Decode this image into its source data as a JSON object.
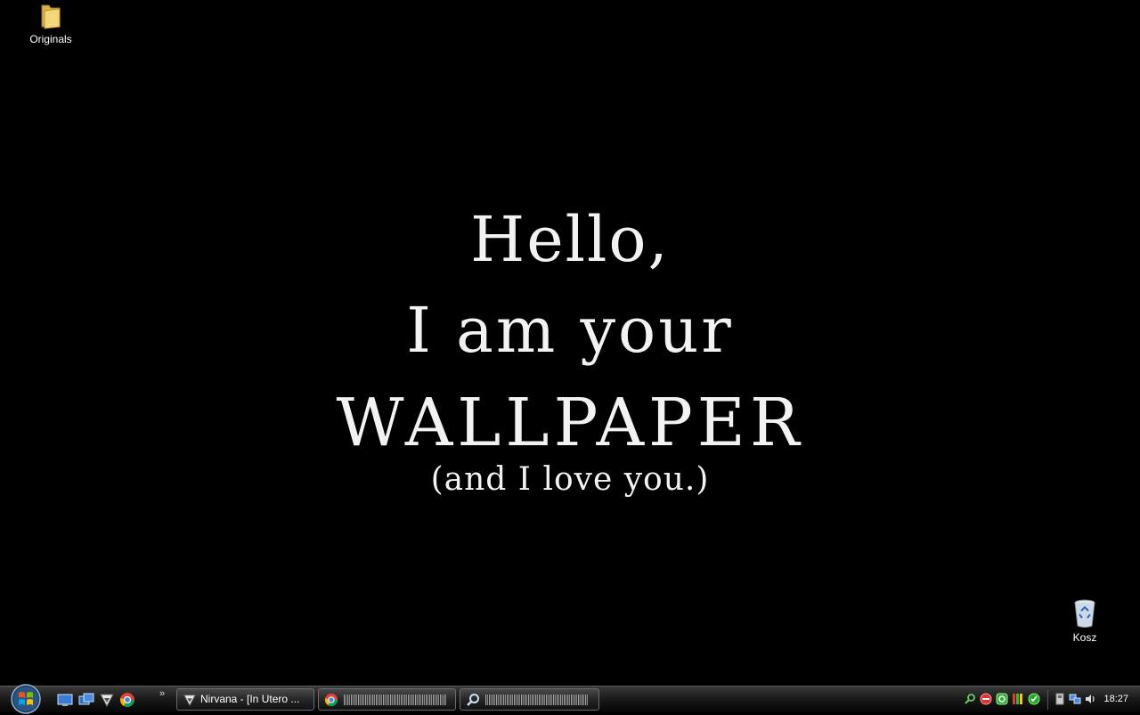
{
  "desktop": {
    "icons": [
      {
        "label": "Originals",
        "icon": "folder-icon"
      },
      {
        "label": "Kosz",
        "icon": "recycle-bin-icon"
      }
    ],
    "wallpaper": {
      "line1": "Hello,",
      "line2": "I am your",
      "line3": "WALLPAPER",
      "line4": "(and I love you.)"
    }
  },
  "taskbar": {
    "quick_launch": [
      "show-desktop-icon",
      "switch-windows-icon",
      "winamp-icon",
      "chrome-icon"
    ],
    "tasks": [
      {
        "label": "Nirvana - [In Utero ...",
        "icon": "winamp-icon"
      },
      {
        "label": "",
        "icon": "chrome-icon"
      },
      {
        "label": "",
        "icon": "search-icon"
      }
    ],
    "tray_icons": [
      "search-tray-icon",
      "stop-tray-icon",
      "green-app-tray-icon",
      "bars-tray-icon",
      "update-tray-icon",
      "usb-tray-icon",
      "network-tray-icon",
      "volume-tray-icon"
    ],
    "clock": "18:27"
  },
  "colors": {
    "background": "#000000",
    "wallpaper_text": "#f2f2f2",
    "taskbar": "#1b1b1b"
  }
}
